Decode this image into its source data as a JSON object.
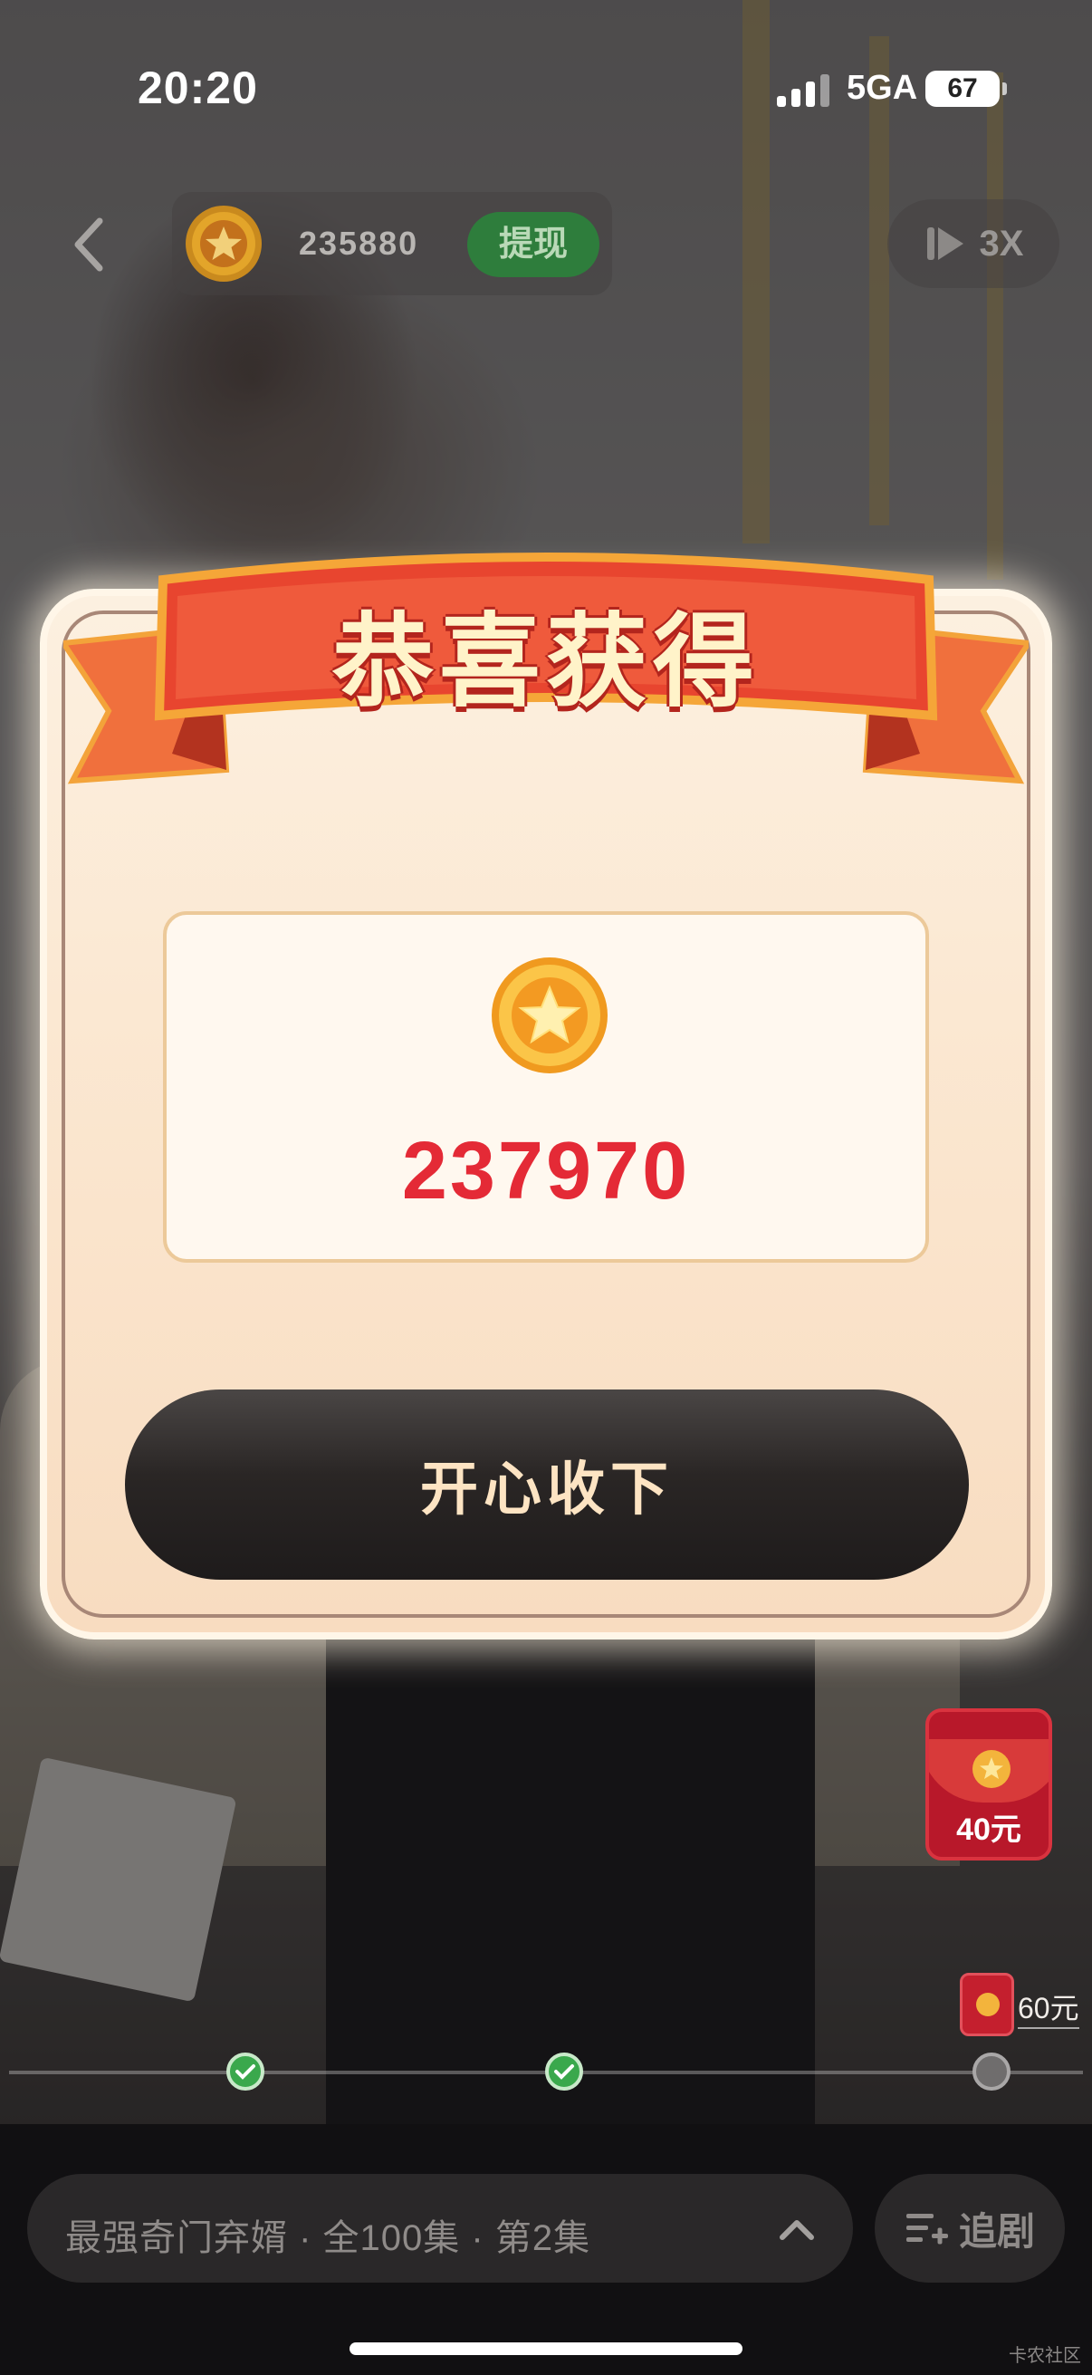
{
  "status_bar": {
    "time": "20:20",
    "network": "5GA",
    "battery": "67"
  },
  "top_bar": {
    "coin_balance": "235880",
    "withdraw_label": "提现",
    "speed_label": "3X"
  },
  "dialog": {
    "title": "恭喜获得",
    "reward_amount": "237970",
    "accept_label": "开心收下"
  },
  "side_rewards": {
    "red_packet_label": "40元",
    "small_packet_label": "60元"
  },
  "progress": {
    "nodes": [
      {
        "state": "done"
      },
      {
        "state": "done"
      },
      {
        "state": "pending"
      }
    ]
  },
  "bottom_bar": {
    "series_title": "最强奇门弃婿 · 全100集 · 第2集",
    "follow_label": "追剧"
  },
  "watermark": "卡农社区",
  "colors": {
    "accent_red": "#e42a36",
    "withdraw_green": "#2e7d3c",
    "ribbon_red": "#e8452f",
    "coin_gold": "#f6b62e"
  }
}
